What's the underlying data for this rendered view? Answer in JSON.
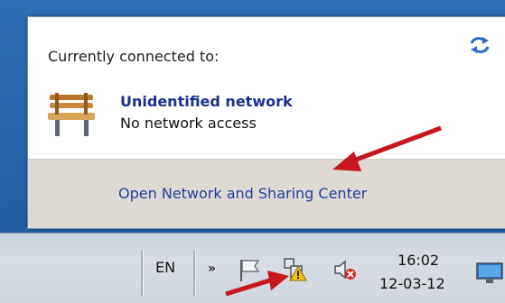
{
  "flyout": {
    "heading": "Currently connected to:",
    "network_name": "Unidentified network",
    "network_status": "No network access",
    "open_center_link": "Open Network and Sharing Center"
  },
  "taskbar": {
    "language": "EN",
    "show_hidden_icons": "»",
    "clock_time": "16:02",
    "clock_date": "12-03-12"
  },
  "icons": [
    "refresh-icon",
    "network-bench-icon",
    "action-center-flag-icon",
    "network-warning-icon",
    "volume-muted-icon",
    "show-desktop-icon"
  ],
  "colors": {
    "annotation_arrow": "#c8161d",
    "link": "#1d3f9b",
    "network_name": "#1b2f8c"
  }
}
